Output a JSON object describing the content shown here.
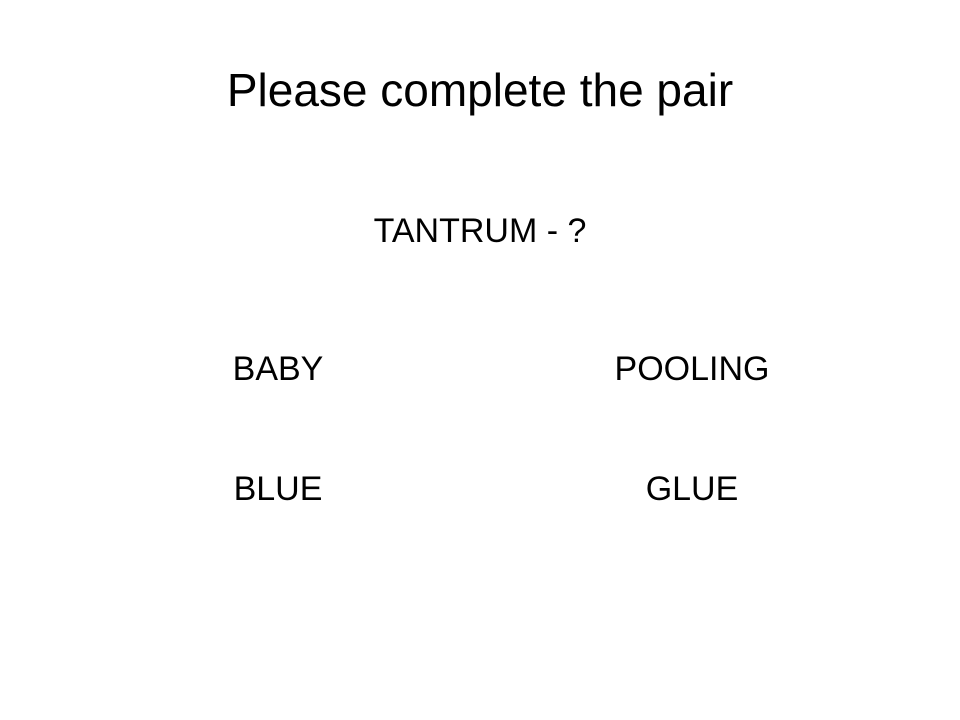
{
  "slide": {
    "title": "Please complete the pair",
    "prompt": "TANTRUM - ?",
    "options": [
      {
        "label": "BABY"
      },
      {
        "label": "POOLING"
      },
      {
        "label": "BLUE"
      },
      {
        "label": "GLUE"
      }
    ]
  },
  "colors": {
    "background": "#ffffff",
    "text": "#000000"
  }
}
